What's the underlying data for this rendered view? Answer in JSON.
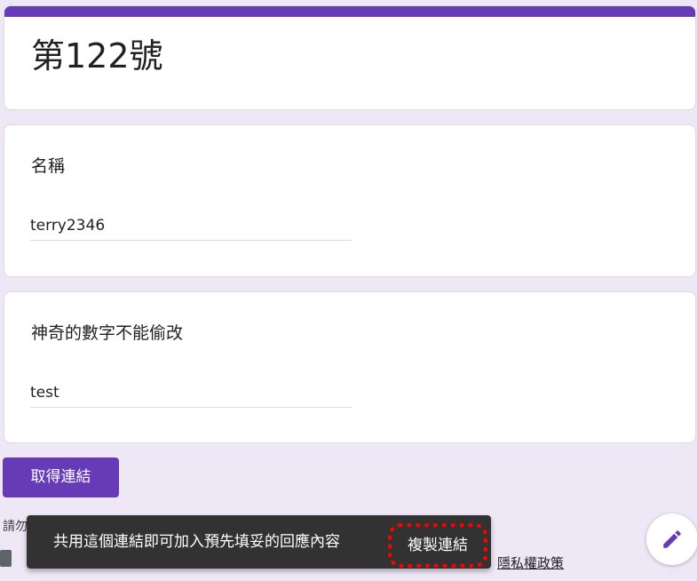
{
  "form": {
    "title": "第122號",
    "accent_color": "#673ab7"
  },
  "questions": [
    {
      "label": "名稱",
      "answer": "terry2346"
    },
    {
      "label": "神奇的數字不能偷改",
      "answer": "test"
    }
  ],
  "get_link_button": {
    "label": "取得連結"
  },
  "footer": {
    "partial_text": "請勿",
    "separator": "-",
    "privacy_link": "隱私權政策"
  },
  "snackbar": {
    "message": "共用這個連結即可加入預先填妥的回應內容",
    "action_label": "複製連結",
    "highlight_color": "#ff0000"
  },
  "fab": {
    "icon": "pencil-icon"
  }
}
